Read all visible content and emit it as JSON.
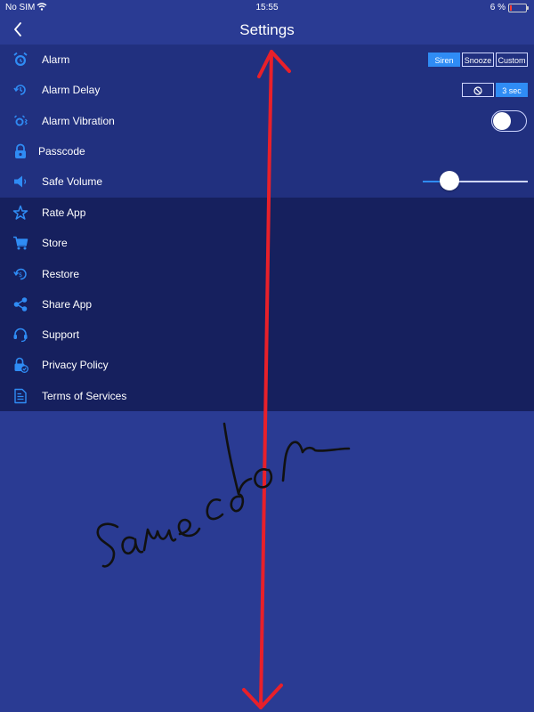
{
  "status_bar": {
    "carrier": "No SIM",
    "time": "15:55",
    "battery": "6 %"
  },
  "header": {
    "title": "Settings"
  },
  "settings_group_1": {
    "alarm": {
      "label": "Alarm",
      "options": [
        "Siren",
        "Snooze",
        "Custom"
      ],
      "selected": "Siren"
    },
    "alarm_delay": {
      "label": "Alarm Delay",
      "options": [
        "3 sec"
      ],
      "selected": "3 sec"
    },
    "alarm_vibration": {
      "label": "Alarm Vibration",
      "enabled": false
    },
    "passcode": {
      "label": "Passcode"
    },
    "safe_volume": {
      "label": "Safe Volume",
      "level": 0.25
    }
  },
  "settings_group_2": {
    "items": [
      {
        "label": "Rate App",
        "icon": "star-icon"
      },
      {
        "label": "Store",
        "icon": "cart-icon"
      },
      {
        "label": "Restore",
        "icon": "restore-icon"
      },
      {
        "label": "Share App",
        "icon": "share-icon"
      },
      {
        "label": "Support",
        "icon": "headset-icon"
      },
      {
        "label": "Privacy Policy",
        "icon": "lock-check-icon"
      },
      {
        "label": "Terms of Services",
        "icon": "document-icon"
      }
    ]
  },
  "handwritten_note": "Samecolor",
  "colors": {
    "accent": "#2f8cf5",
    "background": "#2a3b93",
    "section_1": "#21307f",
    "section_2": "#16205e",
    "annotation_arrow": "#e8202a"
  }
}
